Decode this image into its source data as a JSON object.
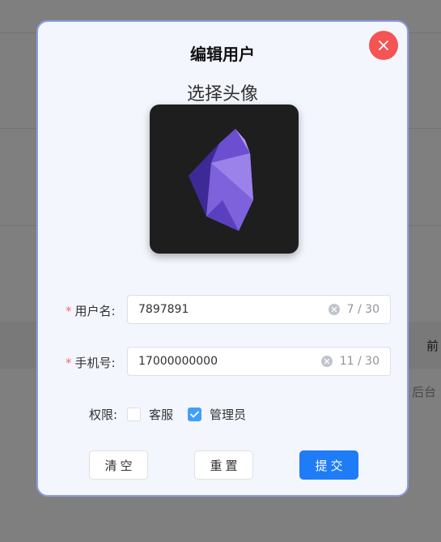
{
  "background": {
    "right_text_1": "前",
    "right_text_2": "后台"
  },
  "modal": {
    "title": "编辑用户",
    "avatar_heading": "选择头像",
    "username": {
      "required_mark": "*",
      "label": "用户名:",
      "value": "7897891",
      "count": "7 / 30"
    },
    "phone": {
      "required_mark": "*",
      "label": "手机号:",
      "value": "17000000000",
      "count": "11 / 30"
    },
    "permission": {
      "label": "权限:",
      "options": [
        {
          "label": "客服",
          "checked": false
        },
        {
          "label": "管理员",
          "checked": true
        }
      ]
    },
    "buttons": {
      "clear": "清空",
      "reset": "重置",
      "submit": "提交"
    }
  },
  "colors": {
    "close_button": "#f45454",
    "primary": "#1f7cf7",
    "checkbox_checked": "#409eff",
    "required": "#f56c6c",
    "modal_border": "#8f9ee4",
    "avatar_gem": "#7b5fd8"
  },
  "icons": {
    "close": "close-icon",
    "clear": "clear-icon",
    "check": "check-icon",
    "avatar": "purple-gem-logo"
  }
}
